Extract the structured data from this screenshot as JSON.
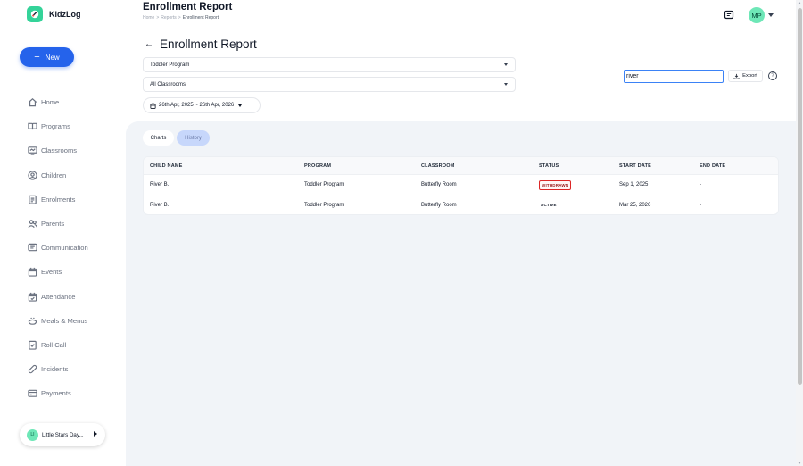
{
  "brand": {
    "name": "KidzLog",
    "color": "#34d399"
  },
  "new_button": {
    "label": "New"
  },
  "nav": [
    {
      "label": "Home",
      "icon": "home-icon"
    },
    {
      "label": "Programs",
      "icon": "book-icon"
    },
    {
      "label": "Classrooms",
      "icon": "monitor-icon"
    },
    {
      "label": "Children",
      "icon": "user-circle-icon"
    },
    {
      "label": "Enrolments",
      "icon": "clipboard-icon"
    },
    {
      "label": "Parents",
      "icon": "users-icon"
    },
    {
      "label": "Communication",
      "icon": "message-icon"
    },
    {
      "label": "Events",
      "icon": "calendar-icon"
    },
    {
      "label": "Attendance",
      "icon": "calendar-check-icon"
    },
    {
      "label": "Meals & Menus",
      "icon": "meal-icon"
    },
    {
      "label": "Roll Call",
      "icon": "clipboard-check-icon"
    },
    {
      "label": "Incidents",
      "icon": "bandage-icon"
    },
    {
      "label": "Payments",
      "icon": "card-icon"
    }
  ],
  "org": {
    "initials": "LI",
    "name": "Little Stars Day..."
  },
  "header": {
    "title": "Enrollment Report",
    "breadcrumb": [
      "Home",
      "Reports",
      "Enrollment Report"
    ],
    "separator": ">",
    "avatar_initials": "MP"
  },
  "report": {
    "title": "Enrollment Report",
    "program_select": "Toddler Program",
    "classroom_select": "All Classrooms",
    "date_range": "26th Apr, 2025 ~ 26th Apr, 2026",
    "search_value": "river",
    "export_label": "Export",
    "help": "?"
  },
  "tabs": {
    "charts": "Charts",
    "history": "History"
  },
  "table": {
    "headers": [
      "CHILD NAME",
      "PROGRAM",
      "CLASSROOM",
      "STATUS",
      "START DATE",
      "END DATE"
    ],
    "rows": [
      [
        "River B.",
        "Toddler Program",
        "Butterfly Room",
        "WITHDRAWN",
        "Sep 1, 2025",
        "-"
      ],
      [
        "River B.",
        "Toddler Program",
        "Butterfly Room",
        "ACTIVE",
        "Mar 25, 2026",
        "-"
      ]
    ]
  },
  "colors": {
    "primary": "#2563eb",
    "content_bg": "#f1f4f8",
    "withdrawn": "#dc2626",
    "history_tab": "#c7d7fb"
  }
}
